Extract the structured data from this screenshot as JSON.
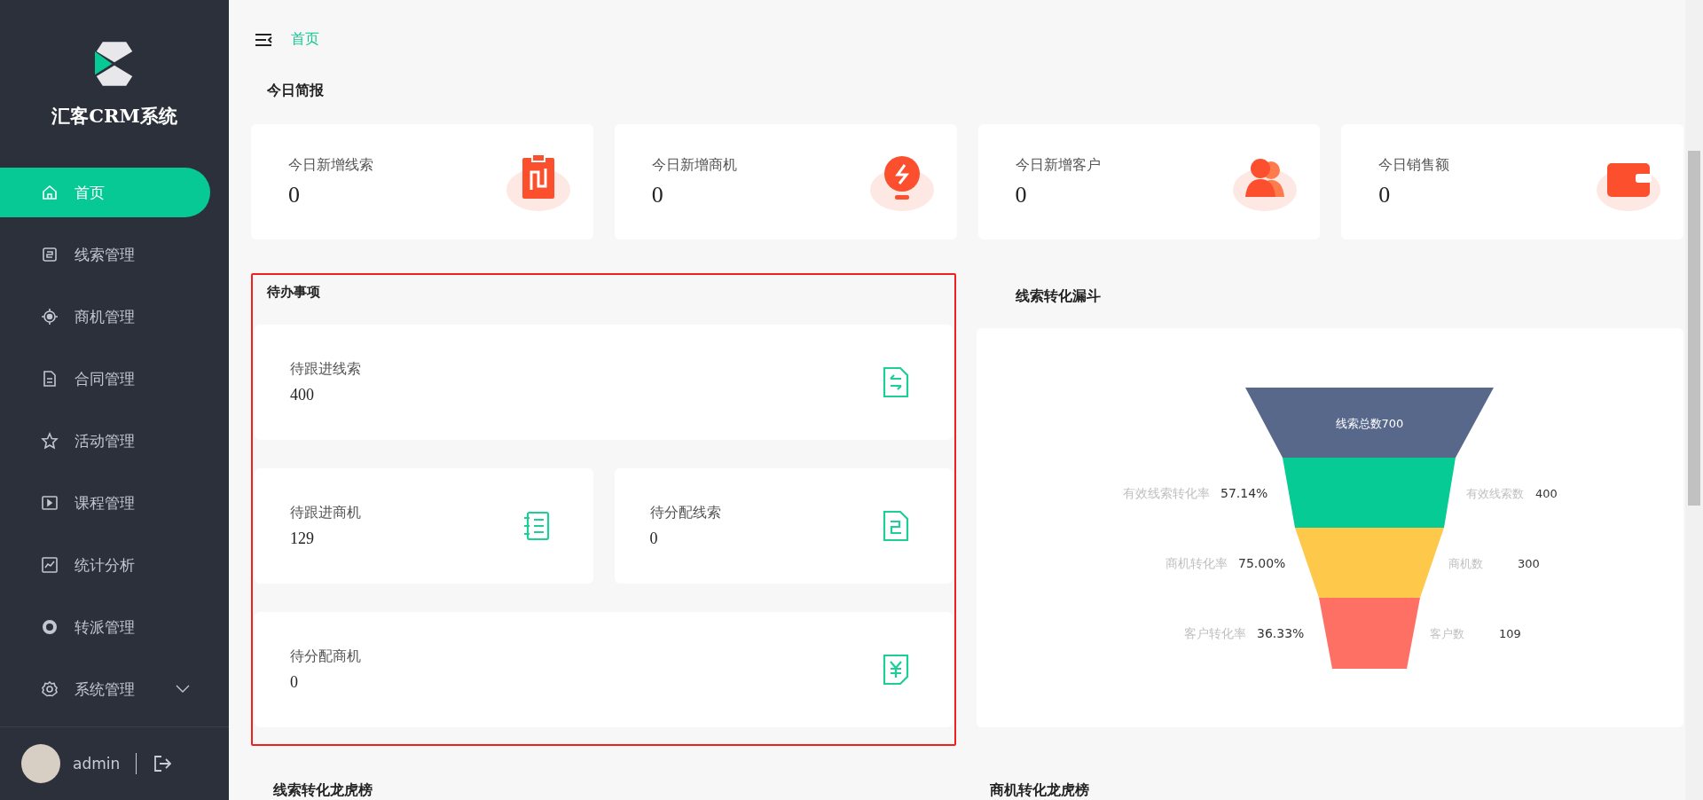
{
  "sidebar": {
    "brand": "汇客CRM系统",
    "items": [
      {
        "label": "首页",
        "selected": true
      },
      {
        "label": "线索管理",
        "selected": false
      },
      {
        "label": "商机管理",
        "selected": false
      },
      {
        "label": "合同管理",
        "selected": false
      },
      {
        "label": "活动管理",
        "selected": false
      },
      {
        "label": "课程管理",
        "selected": false
      },
      {
        "label": "统计分析",
        "selected": false
      },
      {
        "label": "转派管理",
        "selected": false
      },
      {
        "label": "系统管理",
        "selected": false,
        "expandable": true
      }
    ],
    "user": {
      "name": "admin"
    }
  },
  "breadcrumb": "首页",
  "briefing": {
    "title": "今日简报",
    "cards": [
      {
        "label": "今日新增线索",
        "value": "0"
      },
      {
        "label": "今日新增商机",
        "value": "0"
      },
      {
        "label": "今日新增客户",
        "value": "0"
      },
      {
        "label": "今日销售额",
        "value": "0"
      }
    ]
  },
  "todo": {
    "title": "待办事项",
    "items": [
      {
        "label": "待跟进线索",
        "value": "400"
      },
      {
        "label": "待跟进商机",
        "value": "129"
      },
      {
        "label": "待分配线索",
        "value": "0"
      },
      {
        "label": "待分配商机",
        "value": "0"
      }
    ]
  },
  "funnel": {
    "title": "线索转化漏斗",
    "stages": [
      {
        "label": "线索总数700",
        "color": "#58688b"
      },
      {
        "rate_label": "有效线索转化率",
        "rate": "57.14%",
        "name": "有效线索数",
        "value": "400",
        "color": "#06cb94"
      },
      {
        "rate_label": "商机转化率",
        "rate": "75.00%",
        "name": "商机数",
        "value": "300",
        "color": "#fec84a"
      },
      {
        "rate_label": "客户转化率",
        "rate": "36.33%",
        "name": "客户数",
        "value": "109",
        "color": "#fe6f64"
      }
    ]
  },
  "bottom_titles": [
    "线索转化龙虎榜",
    "商机转化龙虎榜"
  ]
}
